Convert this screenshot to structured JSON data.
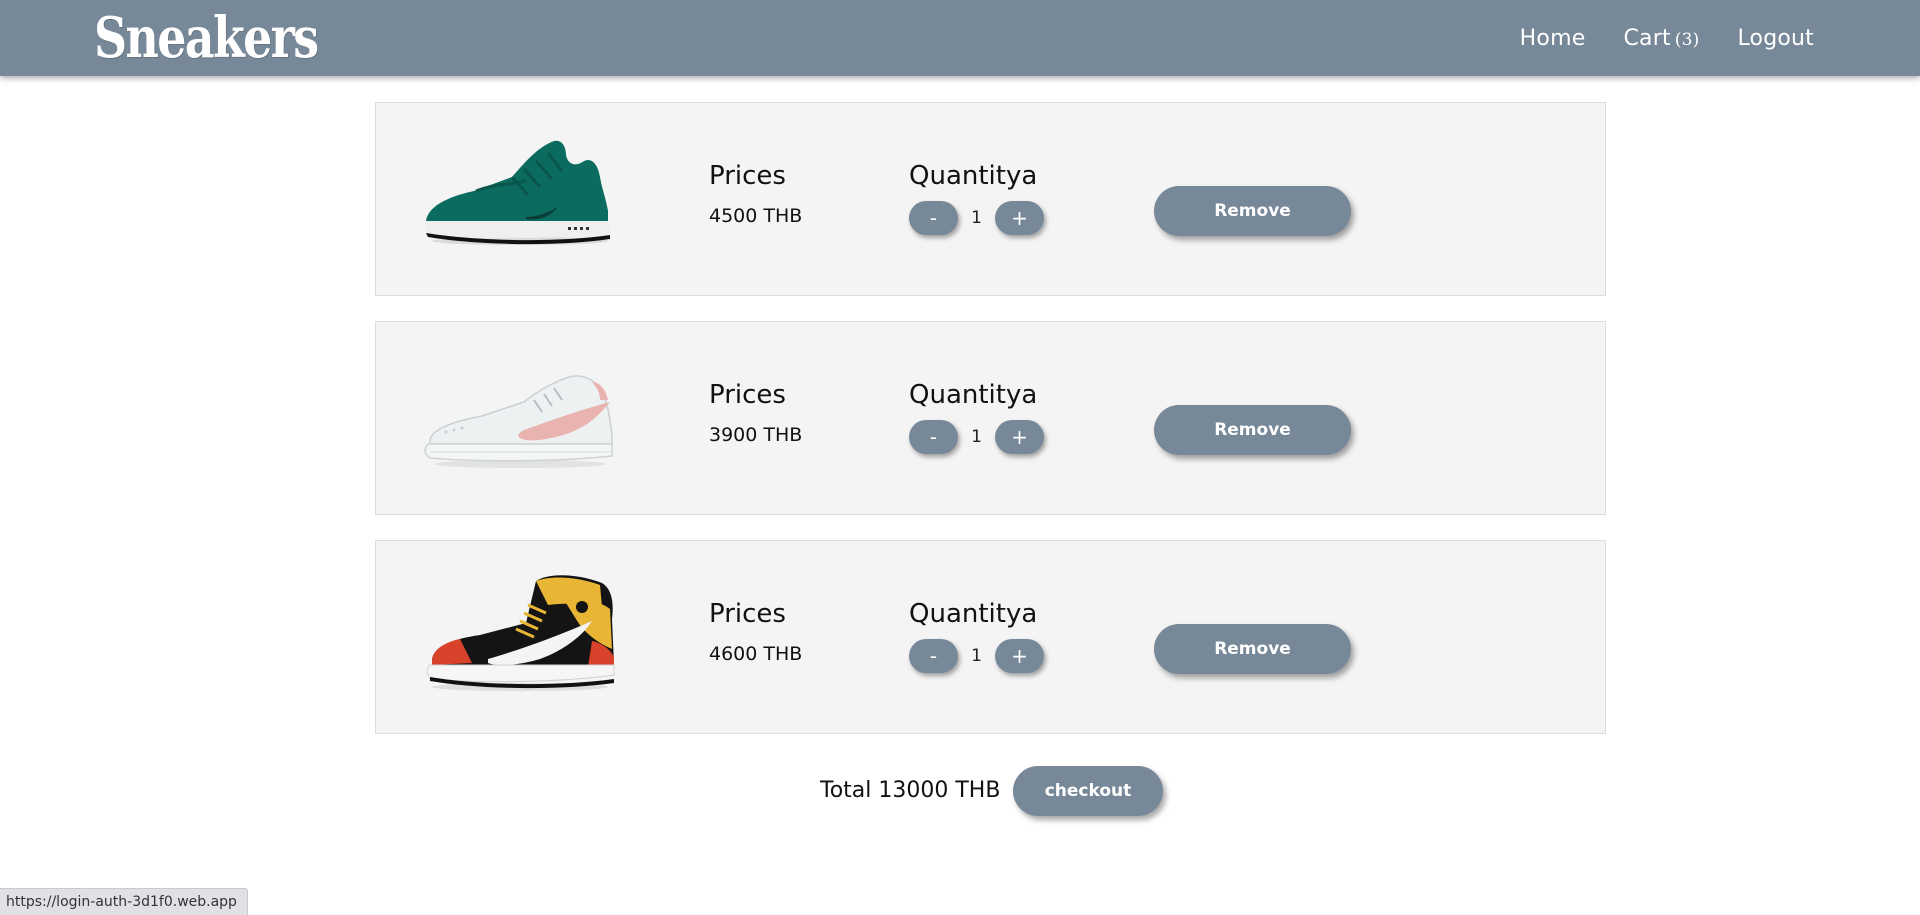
{
  "header": {
    "brand": "Sneakers",
    "nav": {
      "home": "Home",
      "cart": "Cart",
      "cart_count": "(3)",
      "logout": "Logout"
    },
    "color": "#778899"
  },
  "cart": {
    "items": [
      {
        "price_label": "Prices",
        "price": "4500 THB",
        "qty_label": "Quantitya",
        "minus": "-",
        "quantity": "1",
        "plus": "+",
        "remove": "Remove",
        "image": "green-running-shoe"
      },
      {
        "price_label": "Prices",
        "price": "3900 THB",
        "qty_label": "Quantitya",
        "minus": "-",
        "quantity": "1",
        "plus": "+",
        "remove": "Remove",
        "image": "white-pink-low-sneaker"
      },
      {
        "price_label": "Prices",
        "price": "4600 THB",
        "qty_label": "Quantitya",
        "minus": "-",
        "quantity": "1",
        "plus": "+",
        "remove": "Remove",
        "image": "black-red-yellow-high-top"
      }
    ]
  },
  "summary": {
    "total": "Total 13000 THB",
    "checkout": "checkout"
  },
  "status_bar": {
    "url": "https://login-auth-3d1f0.web.app"
  }
}
